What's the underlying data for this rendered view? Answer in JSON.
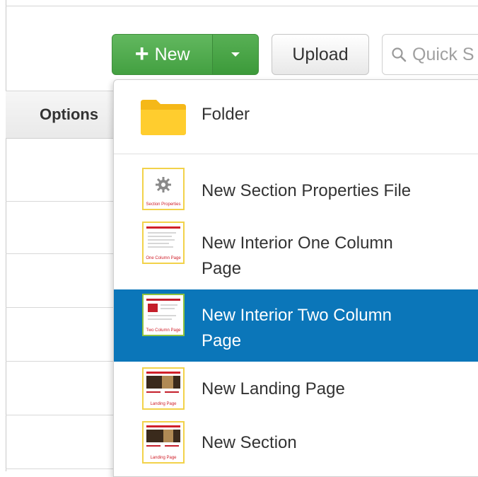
{
  "toolbar": {
    "new_label": "New",
    "upload_label": "Upload",
    "search_placeholder": "Quick S"
  },
  "table": {
    "header_options": "Options"
  },
  "dropdown": {
    "items": [
      {
        "label": "Folder",
        "icon": "folder-icon"
      },
      {
        "label": "New Section Properties File",
        "icon": "section-properties-thumbnail-icon",
        "thumb_caption": "Section Properties"
      },
      {
        "label_line1": "New Interior One Column",
        "label_line2": "Page",
        "icon": "one-column-page-thumbnail-icon",
        "thumb_caption": "One Column Page"
      },
      {
        "label_line1": "New Interior Two Column",
        "label_line2": "Page",
        "icon": "two-column-page-thumbnail-icon",
        "thumb_caption": "Two Column Page",
        "selected": true
      },
      {
        "label": "New Landing Page",
        "icon": "landing-page-thumbnail-icon",
        "thumb_caption": "Landing Page"
      },
      {
        "label": "New Section",
        "icon": "section-thumbnail-icon",
        "thumb_caption": "Landing Page"
      }
    ]
  },
  "colors": {
    "new_button": "#4caf50",
    "selected_item": "#0b76b9",
    "thumbnail_border": "#f2d24a"
  }
}
